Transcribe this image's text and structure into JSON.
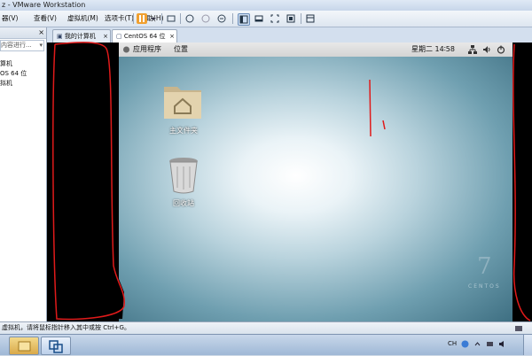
{
  "window": {
    "title": "z - VMware Workstation"
  },
  "menu": {
    "items": [
      "器(V)",
      "查看(V)",
      "虚拟机(M)",
      "选项卡(T)",
      "帮助(H)"
    ]
  },
  "library": {
    "search_placeholder": "内容进行...",
    "tree": [
      "算机",
      "OS 64 位",
      "拟机"
    ]
  },
  "tabs": [
    {
      "label": "我的计算机",
      "active": false
    },
    {
      "label": "CentOS 64 位",
      "active": true
    }
  ],
  "guest": {
    "topbar": {
      "applications": "应用程序",
      "places": "位置",
      "clock": "星期二 14∶58"
    },
    "desktop_icons": [
      {
        "label": "主文件夹",
        "icon": "home-folder-icon"
      },
      {
        "label": "回收站",
        "icon": "trash-icon"
      }
    ],
    "logo": {
      "numeral": "7",
      "text": "CENTOS"
    }
  },
  "statusbar": {
    "text": "虚拟机，请将鼠标指针移入其中或按 Ctrl+G。"
  },
  "tray": {
    "lang": "CH"
  },
  "colors": {
    "annotation_red": "#e01a1a",
    "desktop_accent": "#5f93a6"
  }
}
